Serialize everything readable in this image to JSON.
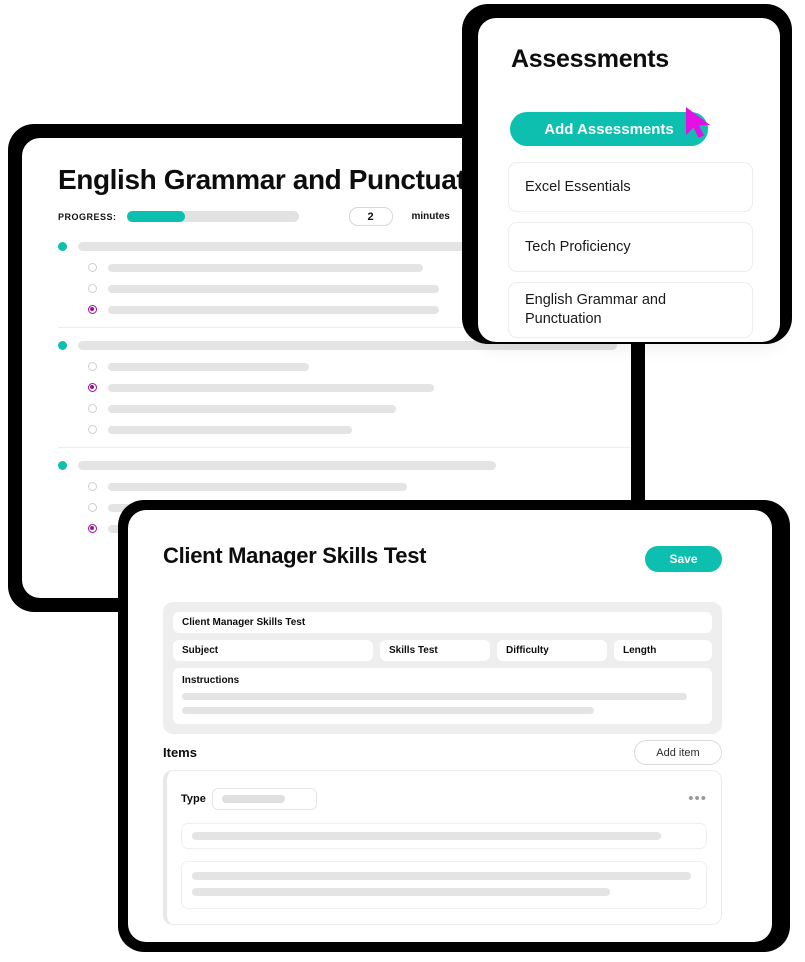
{
  "grammar_card": {
    "title": "English Grammar and Punctuation",
    "progress_label": "PROGRESS:",
    "progress_percent": 34,
    "duration_value": "2",
    "duration_unit": "minutes",
    "accent_color": "#0dbfae",
    "selected_option_color": "#9c0f9c",
    "questions": [
      {
        "bar_width_pct": 82,
        "options": [
          {
            "selected": false,
            "bar_width_pct": 58
          },
          {
            "selected": false,
            "bar_width_pct": 61
          },
          {
            "selected": true,
            "bar_width_pct": 61
          }
        ]
      },
      {
        "bar_width_pct": 94,
        "options": [
          {
            "selected": false,
            "bar_width_pct": 37
          },
          {
            "selected": true,
            "bar_width_pct": 60
          },
          {
            "selected": false,
            "bar_width_pct": 53
          },
          {
            "selected": false,
            "bar_width_pct": 45
          }
        ]
      },
      {
        "bar_width_pct": 73,
        "options": [
          {
            "selected": false,
            "bar_width_pct": 55
          },
          {
            "selected": false,
            "bar_width_pct": 50
          },
          {
            "selected": true,
            "bar_width_pct": 48
          }
        ]
      }
    ]
  },
  "assessments_card": {
    "title": "Assessments",
    "add_button_label": "Add Assessments",
    "button_color": "#0dbfae",
    "cursor_color": "#e50ee5",
    "items": [
      {
        "label": "Excel Essentials"
      },
      {
        "label": "Tech Proficiency"
      },
      {
        "label": "English Grammar and Punctuation"
      }
    ]
  },
  "client_card": {
    "title": "Client Manager Skills Test",
    "save_label": "Save",
    "save_color": "#0dbfae",
    "name_field_value": "Client Manager Skills Test",
    "subject_field_value": "Subject",
    "skills_field_value": "Skills Test",
    "difficulty_field_value": "Difficulty",
    "length_field_value": "Length",
    "instructions_label": "Instructions",
    "instructions_bars": [
      97,
      79
    ],
    "items_label": "Items",
    "add_item_label": "Add item",
    "item": {
      "type_label": "Type",
      "menu_glyph": "•••",
      "body_bars": [
        99,
        83
      ]
    }
  }
}
